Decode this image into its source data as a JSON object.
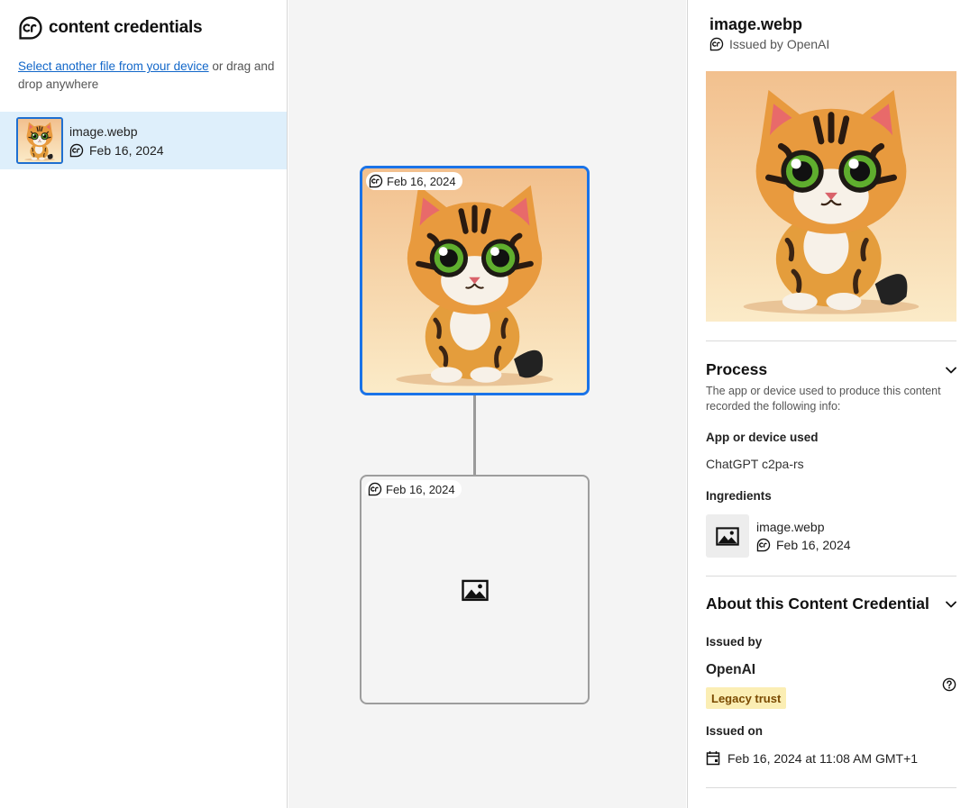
{
  "app": {
    "title": "content credentials"
  },
  "upload": {
    "link_text": "Select another file from your device",
    "rest_text": " or drag and drop anywhere"
  },
  "file_list": [
    {
      "name": "image.webp",
      "date": "Feb 16, 2024",
      "selected": true
    }
  ],
  "graph": {
    "nodes": [
      {
        "date": "Feb 16, 2024",
        "selected": true,
        "has_preview": true
      },
      {
        "date": "Feb 16, 2024",
        "selected": false,
        "has_preview": false
      }
    ]
  },
  "details": {
    "title": "image.webp",
    "issued_by_line": "Issued by OpenAI",
    "process": {
      "heading": "Process",
      "description": "The app or device used to produce this content recorded the following info:",
      "app_label": "App or device used",
      "app_value": "ChatGPT c2pa-rs",
      "ingredients_label": "Ingredients",
      "ingredient": {
        "name": "image.webp",
        "date": "Feb 16, 2024"
      }
    },
    "about": {
      "heading": "About this Content Credential",
      "issued_by_label": "Issued by",
      "issuer": "OpenAI",
      "trust_badge": "Legacy trust",
      "issued_on_label": "Issued on",
      "issued_on_value": "Feb 16, 2024 at 11:08 AM GMT+1"
    }
  },
  "colors": {
    "accent": "#1a73e8",
    "link": "#1267c9",
    "selected_row": "#deeffb",
    "canvas": "#f4f4f4",
    "legacy_badge_bg": "#fbeeb4",
    "legacy_badge_text": "#7a4a00"
  },
  "icons": [
    "cr-logo-icon",
    "cr-badge-icon",
    "image-placeholder-icon",
    "chevron-down-icon",
    "help-icon",
    "calendar-icon"
  ]
}
